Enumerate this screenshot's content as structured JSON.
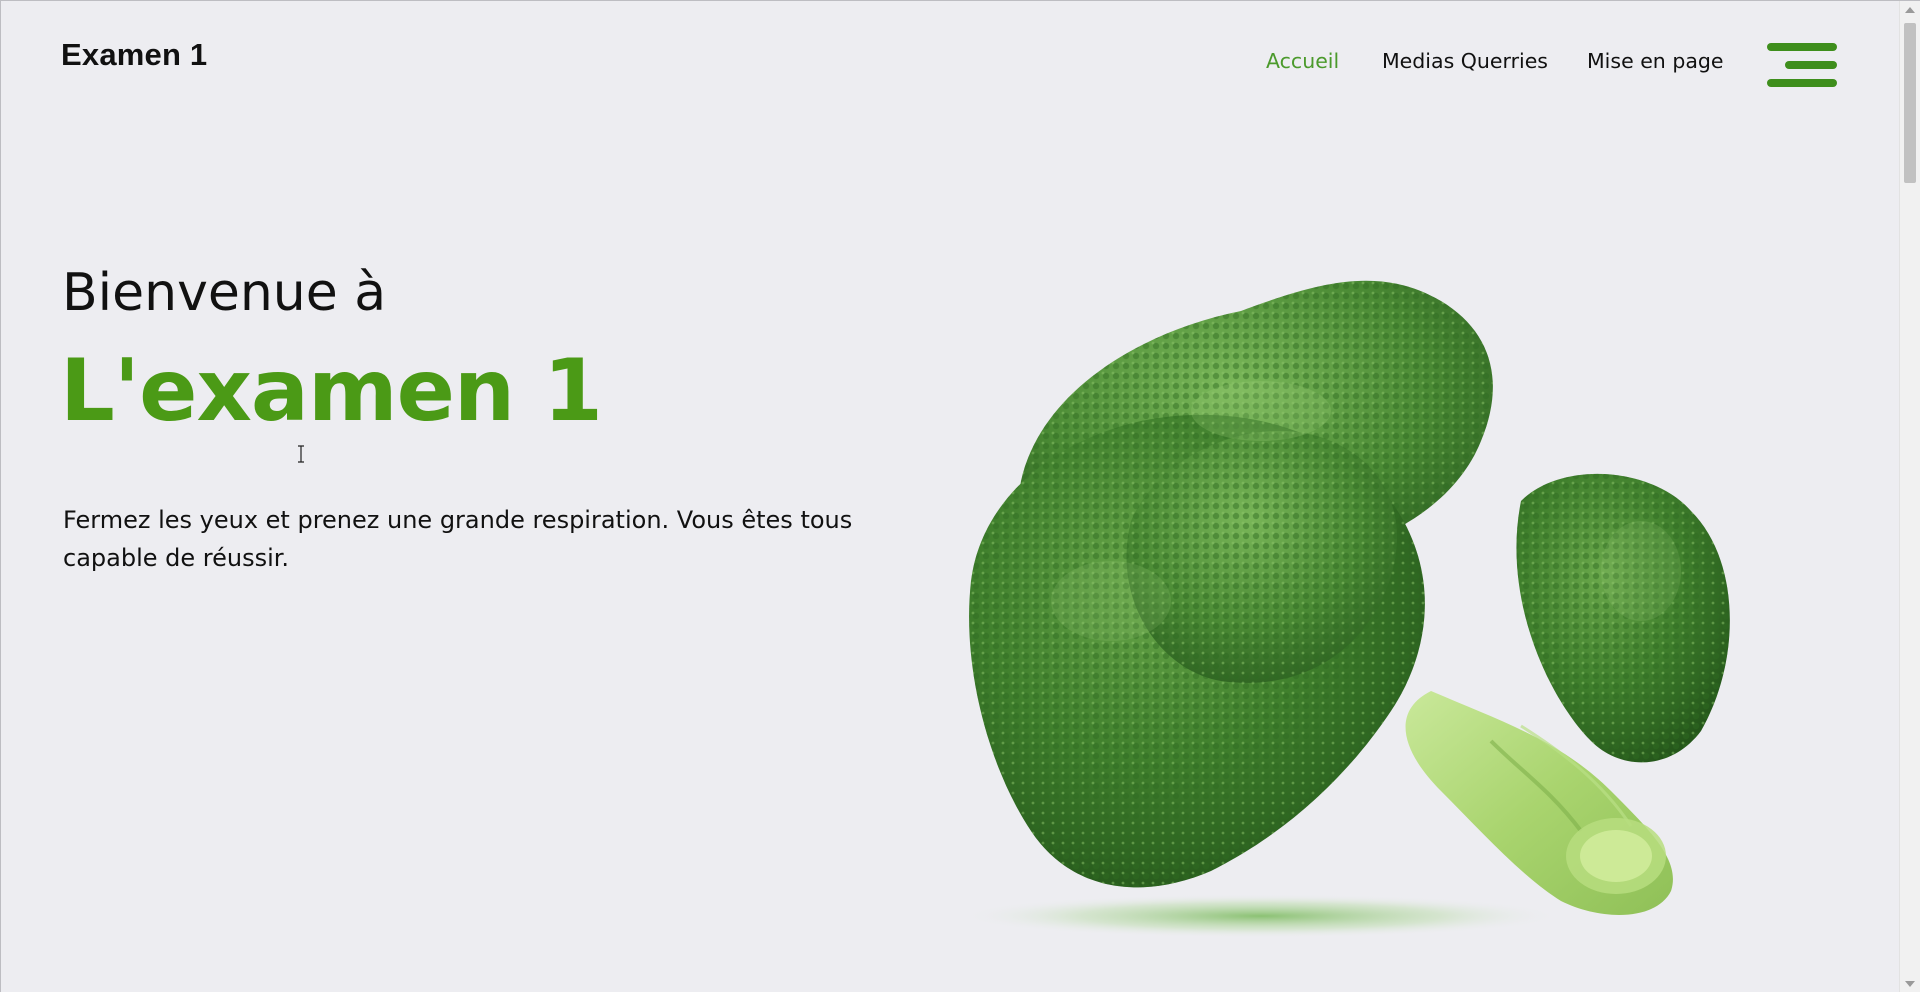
{
  "header": {
    "logo": "Examen 1",
    "nav": [
      {
        "label": "Accueil",
        "active": true
      },
      {
        "label": "Medias Querries",
        "active": false
      },
      {
        "label": "Mise en page",
        "active": false
      }
    ],
    "menu_icon": "hamburger-menu-icon"
  },
  "hero": {
    "pre_title": "Bienvenue à",
    "title": "L'examen 1",
    "text": "Fermez les yeux et prenez une grande respiration. Vous êtes tous capable de réussir."
  },
  "colors": {
    "accent": "#4b9a16",
    "nav_active": "#4b9a2c",
    "background": "#ededf1",
    "text": "#111111"
  }
}
